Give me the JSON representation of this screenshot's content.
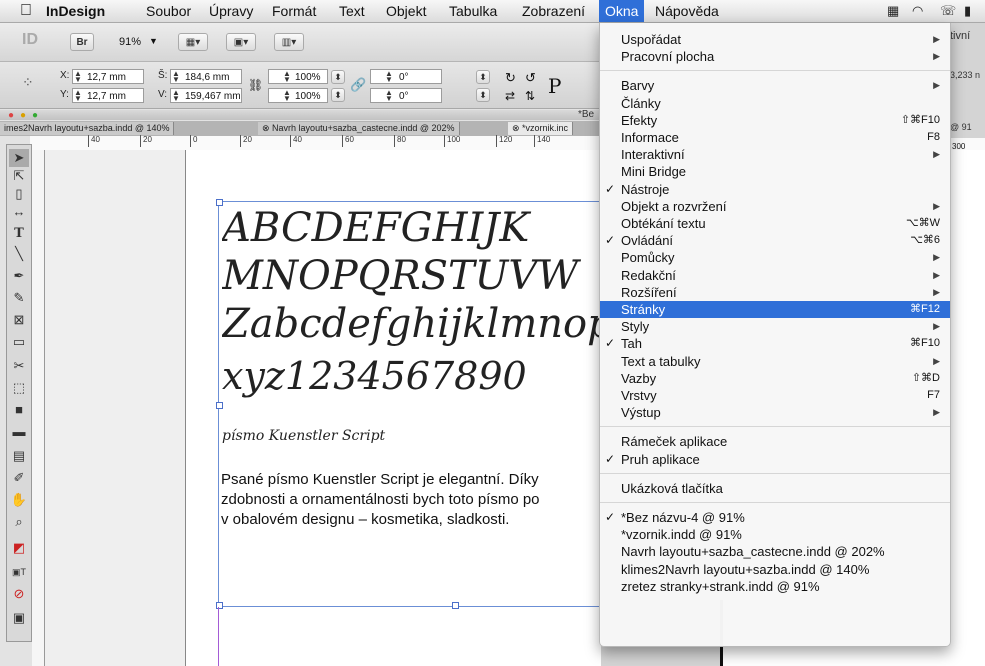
{
  "menubar": {
    "apple": "",
    "app": "InDesign",
    "items": [
      "Soubor",
      "Úpravy",
      "Formát",
      "Text",
      "Objekt",
      "Tabulka",
      "Zobrazení",
      "Okna",
      "Nápověda"
    ]
  },
  "appbar": {
    "logo": "ID",
    "bridge": "Br",
    "zoom": "91%",
    "right_partial": "tivní"
  },
  "controls": {
    "x_label": "X:",
    "x_value": "12,7 mm",
    "y_label": "Y:",
    "y_value": "12,7 mm",
    "w_label": "Š:",
    "w_value": "184,6 mm",
    "h_label": "V:",
    "h_value": "159,467 mm",
    "scale_x": "100%",
    "scale_y": "100%",
    "angle": "0°",
    "shear": "0°",
    "right_value": "3,233 n"
  },
  "tabs": {
    "t1": "imes2Navrh layoutu+sazba.indd @ 140%",
    "t2": "Navrh layoutu+sazba_castecne.indd @ 202%",
    "t3": "*vzornik.inc",
    "titlebar": "*Be",
    "right_tab": "@ 91"
  },
  "ruler": [
    "40",
    "20",
    "0",
    "20",
    "40",
    "60",
    "80",
    "100",
    "120",
    "140"
  ],
  "ruler_right": "300",
  "document": {
    "line1": "ABCDEFGHIJK",
    "line2": "MNOPQRSTUVW",
    "line3": "Zabcdefghijklmnopqrs",
    "line4": "xyz1234567890",
    "caption": "písmo Kuenstler Script",
    "body": [
      "Psané písmo Kuenstler Script je elegantní. Díky",
      "zdobnosti a ornamentálnosti bych toto písmo po",
      "v obalovém designu – kosmetika, sladkosti."
    ]
  },
  "window_menu": {
    "groups": [
      [
        {
          "label": "Uspořádat",
          "submenu": true
        },
        {
          "label": "Pracovní plocha",
          "submenu": true
        }
      ],
      [
        {
          "label": "Barvy",
          "submenu": true
        },
        {
          "label": "Články"
        },
        {
          "label": "Efekty",
          "shortcut": "⇧⌘F10"
        },
        {
          "label": "Informace",
          "shortcut": "F8"
        },
        {
          "label": "Interaktivní",
          "submenu": true
        },
        {
          "label": "Mini Bridge"
        },
        {
          "label": "Nástroje",
          "checked": true
        },
        {
          "label": "Objekt a rozvržení",
          "submenu": true
        },
        {
          "label": "Obtékání textu",
          "shortcut": "⌥⌘W"
        },
        {
          "label": "Ovládání",
          "checked": true,
          "shortcut": "⌥⌘6"
        },
        {
          "label": "Pomůcky",
          "submenu": true
        },
        {
          "label": "Redakční",
          "submenu": true
        },
        {
          "label": "Rozšíření",
          "submenu": true
        },
        {
          "label": "Stránky",
          "shortcut": "⌘F12",
          "selected": true
        },
        {
          "label": "Styly",
          "submenu": true
        },
        {
          "label": "Tah",
          "checked": true,
          "shortcut": "⌘F10"
        },
        {
          "label": "Text a tabulky",
          "submenu": true
        },
        {
          "label": "Vazby",
          "shortcut": "⇧⌘D"
        },
        {
          "label": "Vrstvy",
          "shortcut": "F7"
        },
        {
          "label": "Výstup",
          "submenu": true
        }
      ],
      [
        {
          "label": "Rámeček aplikace"
        },
        {
          "label": "Pruh aplikace",
          "checked": true
        }
      ],
      [
        {
          "label": "Ukázková tlačítka"
        }
      ],
      [
        {
          "label": "*Bez názvu-4 @ 91%",
          "checked": true
        },
        {
          "label": "*vzornik.indd @ 91%"
        },
        {
          "label": "Navrh layoutu+sazba_castecne.indd @ 202%"
        },
        {
          "label": "klimes2Navrh layoutu+sazba.indd @ 140%"
        },
        {
          "label": "zretez stranky+strank.indd @ 91%"
        }
      ]
    ]
  },
  "colors": {
    "menu_highlight": "#2f6fd8",
    "frame_blue": "#6b8fd6",
    "margin_purple": "#a45bd6"
  },
  "icons": {
    "check": "✓",
    "submenu": "▶"
  }
}
